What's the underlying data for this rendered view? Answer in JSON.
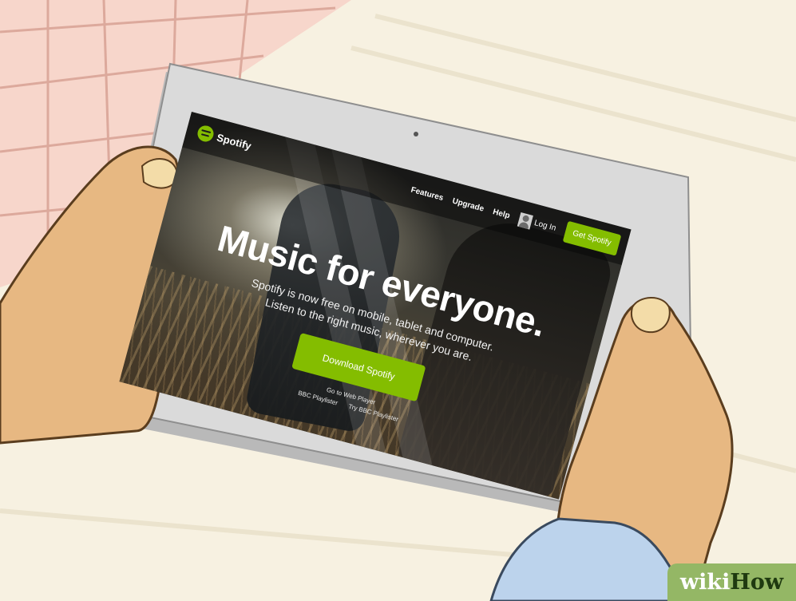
{
  "colors": {
    "spotify_green": "#84bd00",
    "brand_green": "#94b765",
    "tablet_frame": "#d6d6d6",
    "skin": "#e7b882"
  },
  "spotify_page": {
    "logo_text": "Spotify",
    "nav": {
      "features": "Features",
      "upgrade": "Upgrade",
      "help": "Help",
      "login": "Log In",
      "get_spotify": "Get Spotify"
    },
    "headline": "Music for everyone.",
    "subline": "Spotify is now free on mobile, tablet and computer. Listen to the right music, wherever you are.",
    "download_button": "Download Spotify",
    "link_web_player": "Go to Web Player",
    "link_bbc": "BBC Playlister",
    "link_try_bbc": "Try BBC Playlister"
  },
  "watermark": {
    "part1": "wiki",
    "part2": "How"
  }
}
